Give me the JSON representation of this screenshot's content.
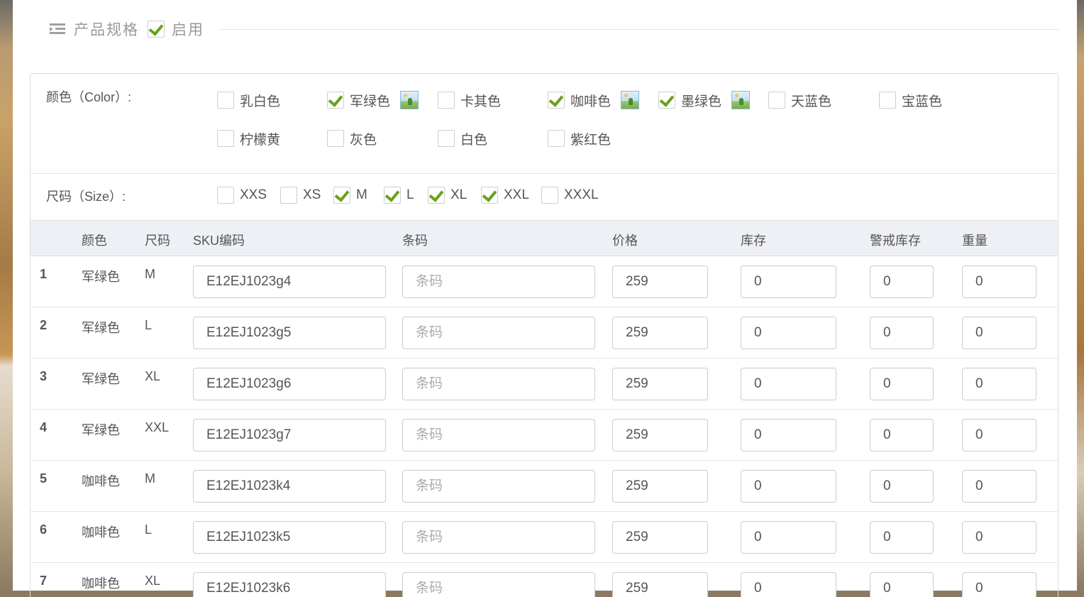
{
  "section": {
    "title": "产品规格",
    "enabled_label": "启用",
    "enabled": true
  },
  "color_options": {
    "label": "颜色（Color）:",
    "items": [
      {
        "name": "乳白色",
        "checked": false,
        "has_image": false
      },
      {
        "name": "军绿色",
        "checked": true,
        "has_image": true
      },
      {
        "name": "卡其色",
        "checked": false,
        "has_image": false
      },
      {
        "name": "咖啡色",
        "checked": true,
        "has_image": true
      },
      {
        "name": "墨绿色",
        "checked": true,
        "has_image": true
      },
      {
        "name": "天蓝色",
        "checked": false,
        "has_image": false
      },
      {
        "name": "宝蓝色",
        "checked": false,
        "has_image": false
      },
      {
        "name": "柠檬黄",
        "checked": false,
        "has_image": false
      },
      {
        "name": "灰色",
        "checked": false,
        "has_image": false
      },
      {
        "name": "白色",
        "checked": false,
        "has_image": false
      },
      {
        "name": "紫红色",
        "checked": false,
        "has_image": false
      }
    ],
    "image_icon": "image-icon"
  },
  "size_options": {
    "label": "尺码（Size）:",
    "items": [
      {
        "name": "XXS",
        "checked": false
      },
      {
        "name": "XS",
        "checked": false
      },
      {
        "name": "M",
        "checked": true
      },
      {
        "name": "L",
        "checked": true
      },
      {
        "name": "XL",
        "checked": true
      },
      {
        "name": "XXL",
        "checked": true
      },
      {
        "name": "XXXL",
        "checked": false
      }
    ]
  },
  "table": {
    "headers": {
      "color": "颜色",
      "size": "尺码",
      "sku": "SKU编码",
      "barcode": "条码",
      "price": "价格",
      "stock": "库存",
      "alert_stock": "警戒库存",
      "weight": "重量"
    },
    "barcode_placeholder": "条码",
    "rows": [
      {
        "idx": "1",
        "color": "军绿色",
        "size": "M",
        "sku": "E12EJ1023g4",
        "price": "259",
        "stock": "0",
        "alert": "0",
        "weight": "0"
      },
      {
        "idx": "2",
        "color": "军绿色",
        "size": "L",
        "sku": "E12EJ1023g5",
        "price": "259",
        "stock": "0",
        "alert": "0",
        "weight": "0"
      },
      {
        "idx": "3",
        "color": "军绿色",
        "size": "XL",
        "sku": "E12EJ1023g6",
        "price": "259",
        "stock": "0",
        "alert": "0",
        "weight": "0"
      },
      {
        "idx": "4",
        "color": "军绿色",
        "size": "XXL",
        "sku": "E12EJ1023g7",
        "price": "259",
        "stock": "0",
        "alert": "0",
        "weight": "0"
      },
      {
        "idx": "5",
        "color": "咖啡色",
        "size": "M",
        "sku": "E12EJ1023k4",
        "price": "259",
        "stock": "0",
        "alert": "0",
        "weight": "0"
      },
      {
        "idx": "6",
        "color": "咖啡色",
        "size": "L",
        "sku": "E12EJ1023k5",
        "price": "259",
        "stock": "0",
        "alert": "0",
        "weight": "0"
      },
      {
        "idx": "7",
        "color": "咖啡色",
        "size": "XL",
        "sku": "E12EJ1023k6",
        "price": "259",
        "stock": "0",
        "alert": "0",
        "weight": "0"
      }
    ]
  },
  "colors": {
    "check": "#6aa01a",
    "header_bg": "#eef0f5",
    "border": "#dddddd"
  }
}
